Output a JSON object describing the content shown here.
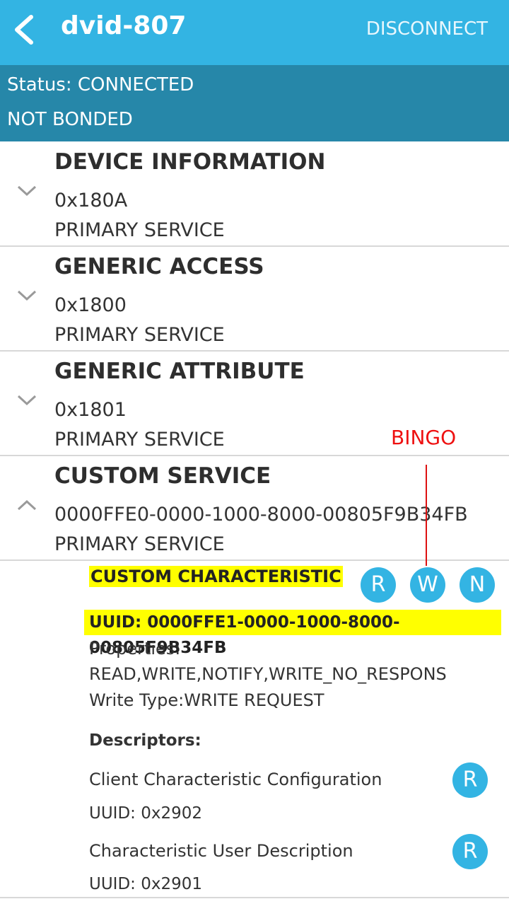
{
  "app_bar": {
    "title": "dvid-807",
    "disconnect_label": "DISCONNECT"
  },
  "status": {
    "connection": "Status: CONNECTED",
    "bond": "NOT BONDED"
  },
  "services": [
    {
      "name": "DEVICE INFORMATION",
      "uuid": "0x180A",
      "type": "PRIMARY SERVICE",
      "expanded": false
    },
    {
      "name": "GENERIC ACCESS",
      "uuid": "0x1800",
      "type": "PRIMARY SERVICE",
      "expanded": false
    },
    {
      "name": "GENERIC ATTRIBUTE",
      "uuid": "0x1801",
      "type": "PRIMARY SERVICE",
      "expanded": false
    },
    {
      "name": "CUSTOM SERVICE",
      "uuid": "0000FFE0-0000-1000-8000-00805F9B34FB",
      "type": "PRIMARY SERVICE",
      "expanded": true
    }
  ],
  "characteristic": {
    "name": "CUSTOM CHARACTERISTIC",
    "uuid": "UUID: 0000FFE1-0000-1000-8000-00805F9B34FB",
    "properties_label": "Properties:",
    "properties": "READ,WRITE,NOTIFY,WRITE_NO_RESPONS",
    "write_type": "Write Type:WRITE REQUEST",
    "buttons": {
      "read": "R",
      "write": "W",
      "notify": "N"
    }
  },
  "descriptors": {
    "header": "Descriptors:",
    "items": [
      {
        "name": "Client Characteristic Configuration",
        "uuid": "UUID: 0x2902",
        "button": "R"
      },
      {
        "name": "Characteristic User Description",
        "uuid": "UUID: 0x2901",
        "button": "R"
      }
    ]
  },
  "annotation": {
    "label": "BINGO",
    "color": "#ee1111"
  },
  "colors": {
    "app_bar": "#33b4e3",
    "status_bar": "#2687a9",
    "highlight": "#ffff00",
    "button": "#33b4e3"
  }
}
